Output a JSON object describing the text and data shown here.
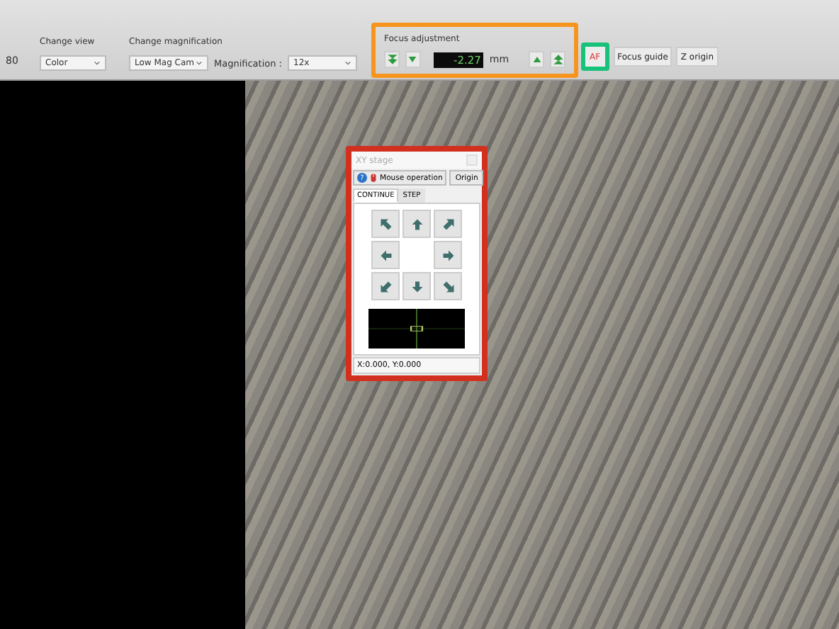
{
  "toolbar": {
    "left_value": "80",
    "view": {
      "label": "Change view",
      "value": "Color"
    },
    "magnification": {
      "label": "Change magnification",
      "camera": "Low Mag Cam",
      "field_label": "Magnification :",
      "value": "12x"
    },
    "focus": {
      "label": "Focus adjustment",
      "value": "-2.27",
      "unit": "mm",
      "highlighted": true
    },
    "buttons": [
      {
        "kind": "af",
        "label": "AF",
        "highlighted": true
      },
      {
        "kind": "plain",
        "label": "Focus guide",
        "highlighted": false
      },
      {
        "kind": "plain",
        "label": "Z origin",
        "highlighted": false
      }
    ]
  },
  "xy_stage": {
    "title": "XY stage",
    "highlighted": true,
    "help_glyph": "?",
    "mouse_button": "Mouse operation",
    "origin_button": "Origin",
    "tabs": [
      {
        "label": "CONTINUE",
        "selected": true
      },
      {
        "label": "STEP",
        "selected": false
      }
    ],
    "position": "X:0.000, Y:0.000"
  }
}
